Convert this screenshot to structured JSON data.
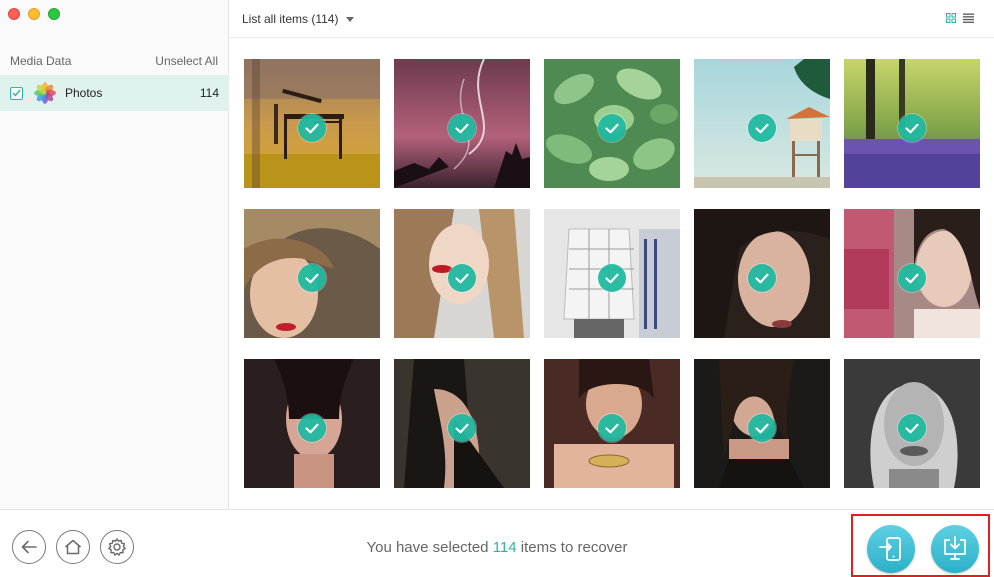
{
  "sidebar": {
    "header_title": "Media Data",
    "unselect_label": "Unselect All",
    "items": [
      {
        "label": "Photos",
        "count": "114",
        "checked": true,
        "icon": "photos-app-icon"
      }
    ]
  },
  "topbar": {
    "list_title": "List all items (114)",
    "view_modes": [
      "grid-view-icon",
      "list-view-icon"
    ],
    "active_view": "grid"
  },
  "gallery": {
    "photos": [
      {
        "name": "photo-bench-autumn",
        "selected": true
      },
      {
        "name": "photo-sunset-silhouette",
        "selected": true
      },
      {
        "name": "photo-succulent",
        "selected": true
      },
      {
        "name": "photo-lifeguard-tower",
        "selected": true
      },
      {
        "name": "photo-lavender-field",
        "selected": true
      },
      {
        "name": "photo-portrait-1",
        "selected": true
      },
      {
        "name": "photo-portrait-2",
        "selected": true
      },
      {
        "name": "photo-portrait-3",
        "selected": true
      },
      {
        "name": "photo-portrait-4",
        "selected": true
      },
      {
        "name": "photo-portrait-5",
        "selected": true
      },
      {
        "name": "photo-portrait-6",
        "selected": true
      },
      {
        "name": "photo-portrait-7",
        "selected": true
      },
      {
        "name": "photo-portrait-8",
        "selected": true
      },
      {
        "name": "photo-portrait-9",
        "selected": true
      },
      {
        "name": "photo-portrait-10",
        "selected": true
      }
    ]
  },
  "bottombar": {
    "status_prefix": "You have selected",
    "status_count": "114",
    "status_suffix": "items to recover",
    "nav_buttons": [
      "back-icon",
      "home-icon",
      "settings-icon"
    ],
    "actions": [
      "recover-to-device-icon",
      "recover-to-computer-icon"
    ]
  },
  "colors": {
    "accent": "#2bb79c",
    "selected_row": "#dff2ee",
    "highlight_frame": "#e02020",
    "action_button": "#3cbfd6"
  }
}
